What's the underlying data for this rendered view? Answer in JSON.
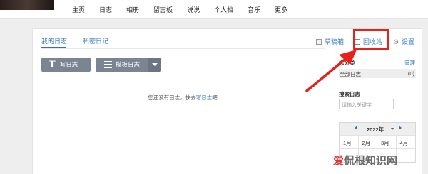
{
  "nav": {
    "items": [
      "主页",
      "日志",
      "相册",
      "留言板",
      "说说",
      "个人档",
      "音乐",
      "更多"
    ]
  },
  "tabs": {
    "mine": "我的日志",
    "private": "私密日记"
  },
  "toolbar": {
    "drafts_label": "草稿箱",
    "recycle_label": "回收站",
    "settings_label": "设置"
  },
  "actions": {
    "write_icon": "T",
    "write_label": "写日志",
    "template_label": "模板日志"
  },
  "empty_state": {
    "prefix": "您还没有日志，快去",
    "link": "写日志",
    "suffix": "吧"
  },
  "sidebar": {
    "category_title": "志分类",
    "manage_label": "管理",
    "all_label": "全部日志",
    "all_count": "(0)",
    "search_title": "搜索日志",
    "search_placeholder": "请输入关键字",
    "calendar": {
      "year": "2022年",
      "months_row1": [
        "1月",
        "2月",
        "3月",
        "4月"
      ]
    }
  },
  "watermark": {
    "accent": "爱",
    "text": "侃根知识网"
  },
  "colors": {
    "highlight": "#e8201a",
    "link": "#3a7fc0",
    "button": "#7b8591"
  },
  "icons": [
    "drafts-icon",
    "recycle-bin-icon",
    "gear-icon",
    "text-T-icon",
    "template-grid-icon",
    "chevron-down-icon",
    "calendar-prev-icon",
    "calendar-next-icon"
  ]
}
